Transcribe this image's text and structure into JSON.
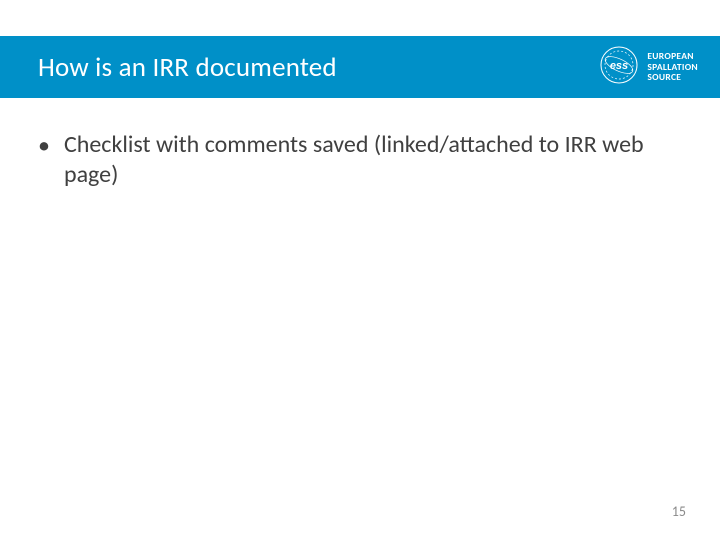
{
  "header": {
    "title": "How is an IRR documented",
    "org": {
      "line1": "EUROPEAN",
      "line2": "SPALLATION",
      "line3": "SOURCE",
      "logo_label": "ess"
    }
  },
  "body": {
    "bullets": [
      {
        "text": "Checklist with comments saved (linked/attached to IRR web page)"
      }
    ]
  },
  "footer": {
    "page_number": "15"
  },
  "colors": {
    "band": "#0090c8"
  }
}
